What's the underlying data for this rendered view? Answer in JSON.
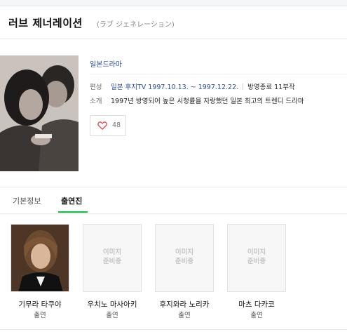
{
  "header": {
    "title": "러브 제너레이션",
    "subtitle": "(ラブ ジェネレーション)"
  },
  "info": {
    "genre": "일본드라마",
    "broadcast_label": "편성",
    "broadcast_value": "일본 후지TV 1997.10.13. ~ 1997.12.22.",
    "status": "방영종료 11부작",
    "intro_label": "소개",
    "intro_value": "1997년 방영되어 높은 시청률을 자랑했던 일본 최고의 트렌디 드라마",
    "likes": "48"
  },
  "tabs": [
    {
      "label": "기본정보"
    },
    {
      "label": "출연진"
    }
  ],
  "cast": [
    {
      "name": "기무라 타쿠야",
      "role": "출연",
      "placeholder": ""
    },
    {
      "name": "우치노 마사아키",
      "role": "출연",
      "placeholder_line1": "이미지",
      "placeholder_line2": "준비중"
    },
    {
      "name": "후지와라 노리카",
      "role": "출연",
      "placeholder_line1": "이미지",
      "placeholder_line2": "준비중"
    },
    {
      "name": "마츠 다카코",
      "role": "출연",
      "placeholder_line1": "이미지",
      "placeholder_line2": "준비중"
    }
  ],
  "colors": {
    "accent_green": "#00c73c",
    "link_blue": "#2a4a9c",
    "heart_red": "#e0464b"
  },
  "icons": {
    "like": "heart-outline-icon"
  }
}
